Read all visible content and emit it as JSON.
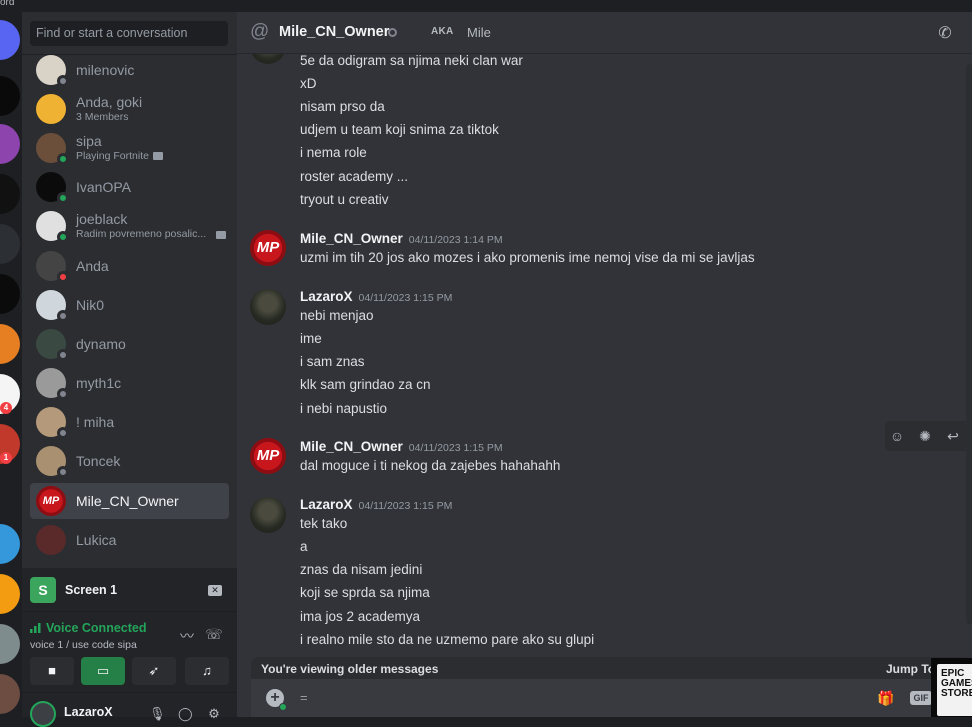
{
  "app": {
    "corner_label": "ord"
  },
  "search": {
    "placeholder": "Find or start a conversation"
  },
  "dms": [
    {
      "name": "milenovic",
      "sub": "",
      "status": "offline",
      "avatar": "#d9d3c7"
    },
    {
      "name": "Anda, goki",
      "sub": "3 Members",
      "status": "none",
      "avatar": "#f0b232"
    },
    {
      "name": "sipa",
      "sub": "Playing Fortnite",
      "status": "online",
      "avatar": "#6b4f3a"
    },
    {
      "name": "IvanOPA",
      "sub": "",
      "status": "online",
      "avatar": "#0b0b0b"
    },
    {
      "name": "joeblack",
      "sub": "Radim povremeno posalic...",
      "status": "online",
      "avatar": "#e0e0e0"
    },
    {
      "name": "Anda",
      "sub": "",
      "status": "dnd",
      "avatar": "#444444"
    },
    {
      "name": "Nik0",
      "sub": "",
      "status": "offline",
      "avatar": "#cfd6dc"
    },
    {
      "name": "dynamo",
      "sub": "",
      "status": "offline",
      "avatar": "#3a4a42"
    },
    {
      "name": "myth1c",
      "sub": "",
      "status": "offline",
      "avatar": "#9a9a9a"
    },
    {
      "name": "! miha",
      "sub": "",
      "status": "offline",
      "avatar": "#b49a7a"
    },
    {
      "name": "Toncek",
      "sub": "",
      "status": "offline",
      "avatar": "#a89070"
    },
    {
      "name": "Mile_CN_Owner",
      "sub": "",
      "status": "none",
      "avatar": "#c8161d",
      "active": true
    },
    {
      "name": "Lukica",
      "sub": "",
      "status": "none",
      "avatar": "#5a2a2a"
    }
  ],
  "voice": {
    "screen_icon": "S",
    "screen_title": "Screen 1",
    "connected_label": "Voice Connected",
    "channel": "voice 1 / use code sipa"
  },
  "user": {
    "name": "LazaroX"
  },
  "header": {
    "name": "Mile_CN_Owner",
    "aka_label": "AKA",
    "aka_value": "Mile"
  },
  "messages": [
    {
      "author": "",
      "time": "",
      "avatar": "lazaro",
      "lines": [
        "5e da odigram sa njima neki clan war",
        "xD",
        "nisam prso da",
        "udjem u team koji snima za tiktok",
        "i nema role",
        "roster academy ...",
        "tryout u creativ"
      ]
    },
    {
      "author": "Mile_CN_Owner",
      "time": "04/11/2023 1:14 PM",
      "avatar": "mile",
      "lines": [
        "uzmi im tih 20 jos ako mozes i ako promenis ime nemoj vise da mi se javljas"
      ]
    },
    {
      "author": "LazaroX",
      "time": "04/11/2023 1:15 PM",
      "avatar": "lazaro",
      "lines": [
        "nebi menjao",
        "ime",
        "i sam znas",
        "klk sam grindao za cn",
        "i nebi napustio"
      ]
    },
    {
      "author": "Mile_CN_Owner",
      "time": "04/11/2023 1:15 PM",
      "avatar": "mile",
      "lines": [
        "dal moguce i ti nekog da zajebes hahahahh"
      ]
    },
    {
      "author": "LazaroX",
      "time": "04/11/2023 1:15 PM",
      "avatar": "lazaro",
      "lines": [
        "tek tako",
        "a",
        "znas da nisam jedini",
        "koji se sprda sa njima",
        "ima jos 2 academya",
        "i realno mile sto da ne uzmemo pare ako su glupi"
      ]
    }
  ],
  "older": {
    "notice": "You're viewing older messages",
    "jump": "Jump To"
  },
  "composer": {
    "text": "=",
    "gif_label": "GIF"
  },
  "ad": {
    "text": "EPIC GAMES STORE"
  },
  "server_badges": [
    "4",
    "1"
  ],
  "colors": {
    "accent": "#23a55a",
    "danger": "#f23f43",
    "bg_chat": "#313338",
    "bg_sidebar": "#2b2d31"
  }
}
